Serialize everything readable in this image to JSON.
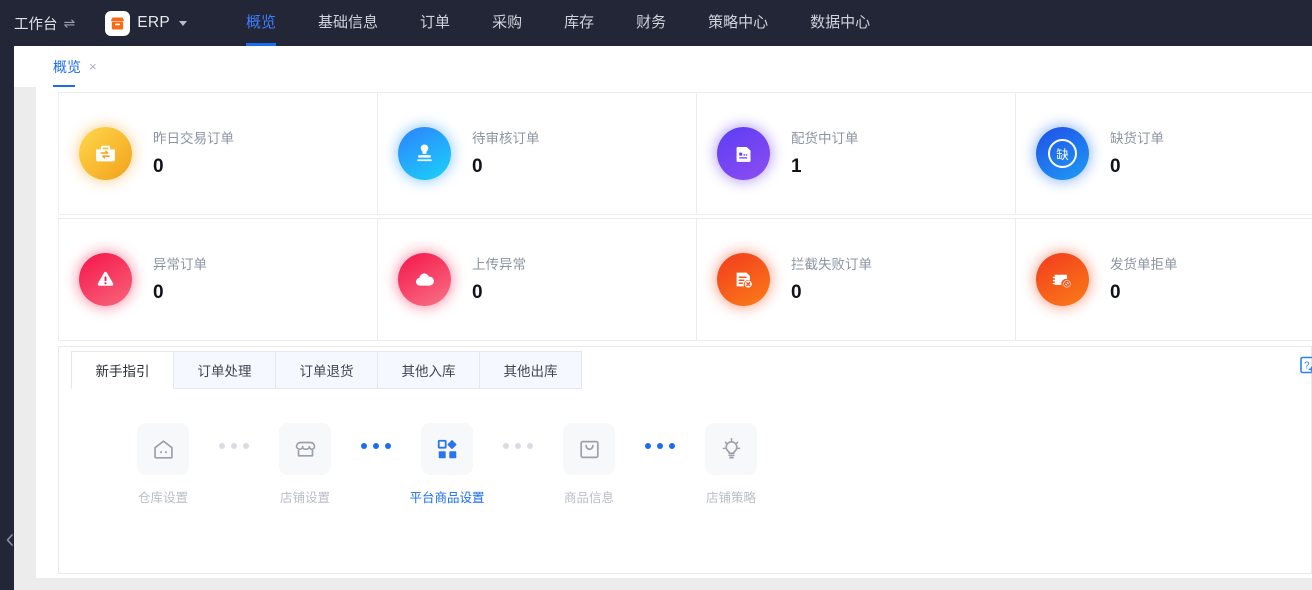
{
  "topnav": {
    "workspace_label": "工作台",
    "workspace_icon": "swap-icon",
    "brand_label": "ERP",
    "brand_icon": "shop-logo-icon",
    "items": [
      {
        "label": "概览",
        "active": true
      },
      {
        "label": "基础信息",
        "active": false
      },
      {
        "label": "订单",
        "active": false
      },
      {
        "label": "采购",
        "active": false
      },
      {
        "label": "库存",
        "active": false
      },
      {
        "label": "财务",
        "active": false
      },
      {
        "label": "策略中心",
        "active": false
      },
      {
        "label": "数据中心",
        "active": false
      }
    ]
  },
  "doc_tab": {
    "label": "概览",
    "close_glyph": "×"
  },
  "rail": {
    "collapse_icon": "chevron-left-icon"
  },
  "stat_cards": [
    {
      "label": "昨日交易订单",
      "value": "0",
      "icon": "exchange-briefcase-icon",
      "color_from": "#ffd233",
      "color_to": "#f5a623"
    },
    {
      "label": "待审核订单",
      "value": "0",
      "icon": "stamp-approval-icon",
      "color_from": "#2f80ff",
      "color_to": "#19d0f5"
    },
    {
      "label": "配货中订单",
      "value": "1",
      "icon": "parcel-box-icon",
      "color_from": "#5b3df5",
      "color_to": "#8b4df0"
    },
    {
      "label": "缺货订单",
      "value": "0",
      "icon": "out-of-stock-icon",
      "icon_text": "缺",
      "color_from": "#1f56e8",
      "color_to": "#1f9cf5"
    },
    {
      "label": "异常订单",
      "value": "0",
      "icon": "warning-triangle-icon",
      "color_from": "#f5144a",
      "color_to": "#f75b75"
    },
    {
      "label": "上传异常",
      "value": "0",
      "icon": "cloud-upload-icon",
      "color_from": "#f5144a",
      "color_to": "#f86a82"
    },
    {
      "label": "拦截失败订单",
      "value": "0",
      "icon": "document-cancel-icon",
      "color_from": "#f23a1e",
      "color_to": "#fb7a18"
    },
    {
      "label": "发货单拒单",
      "value": "0",
      "icon": "shipment-reject-icon",
      "color_from": "#f23a1e",
      "color_to": "#fb7a18"
    }
  ],
  "guide": {
    "tabs": [
      {
        "label": "新手指引",
        "active": true
      },
      {
        "label": "订单处理",
        "active": false
      },
      {
        "label": "订单退货",
        "active": false
      },
      {
        "label": "其他入库",
        "active": false
      },
      {
        "label": "其他出库",
        "active": false
      }
    ],
    "help_icon": "question-gear-icon",
    "steps": [
      {
        "label": "仓库设置",
        "icon": "warehouse-house-icon",
        "active": false
      },
      {
        "label": "店铺设置",
        "icon": "shop-store-icon",
        "active": false
      },
      {
        "label": "平台商品设置",
        "icon": "platform-goods-icon",
        "active": true
      },
      {
        "label": "商品信息",
        "icon": "shopping-bag-icon",
        "active": false
      },
      {
        "label": "店铺策略",
        "icon": "lightbulb-icon",
        "active": false
      }
    ],
    "connectors": [
      {
        "active": false
      },
      {
        "active": true
      },
      {
        "active": false
      },
      {
        "active": true
      }
    ]
  },
  "colors": {
    "accent": "#1b6cf2",
    "navbar": "#232636",
    "page_bg": "#ececec"
  }
}
